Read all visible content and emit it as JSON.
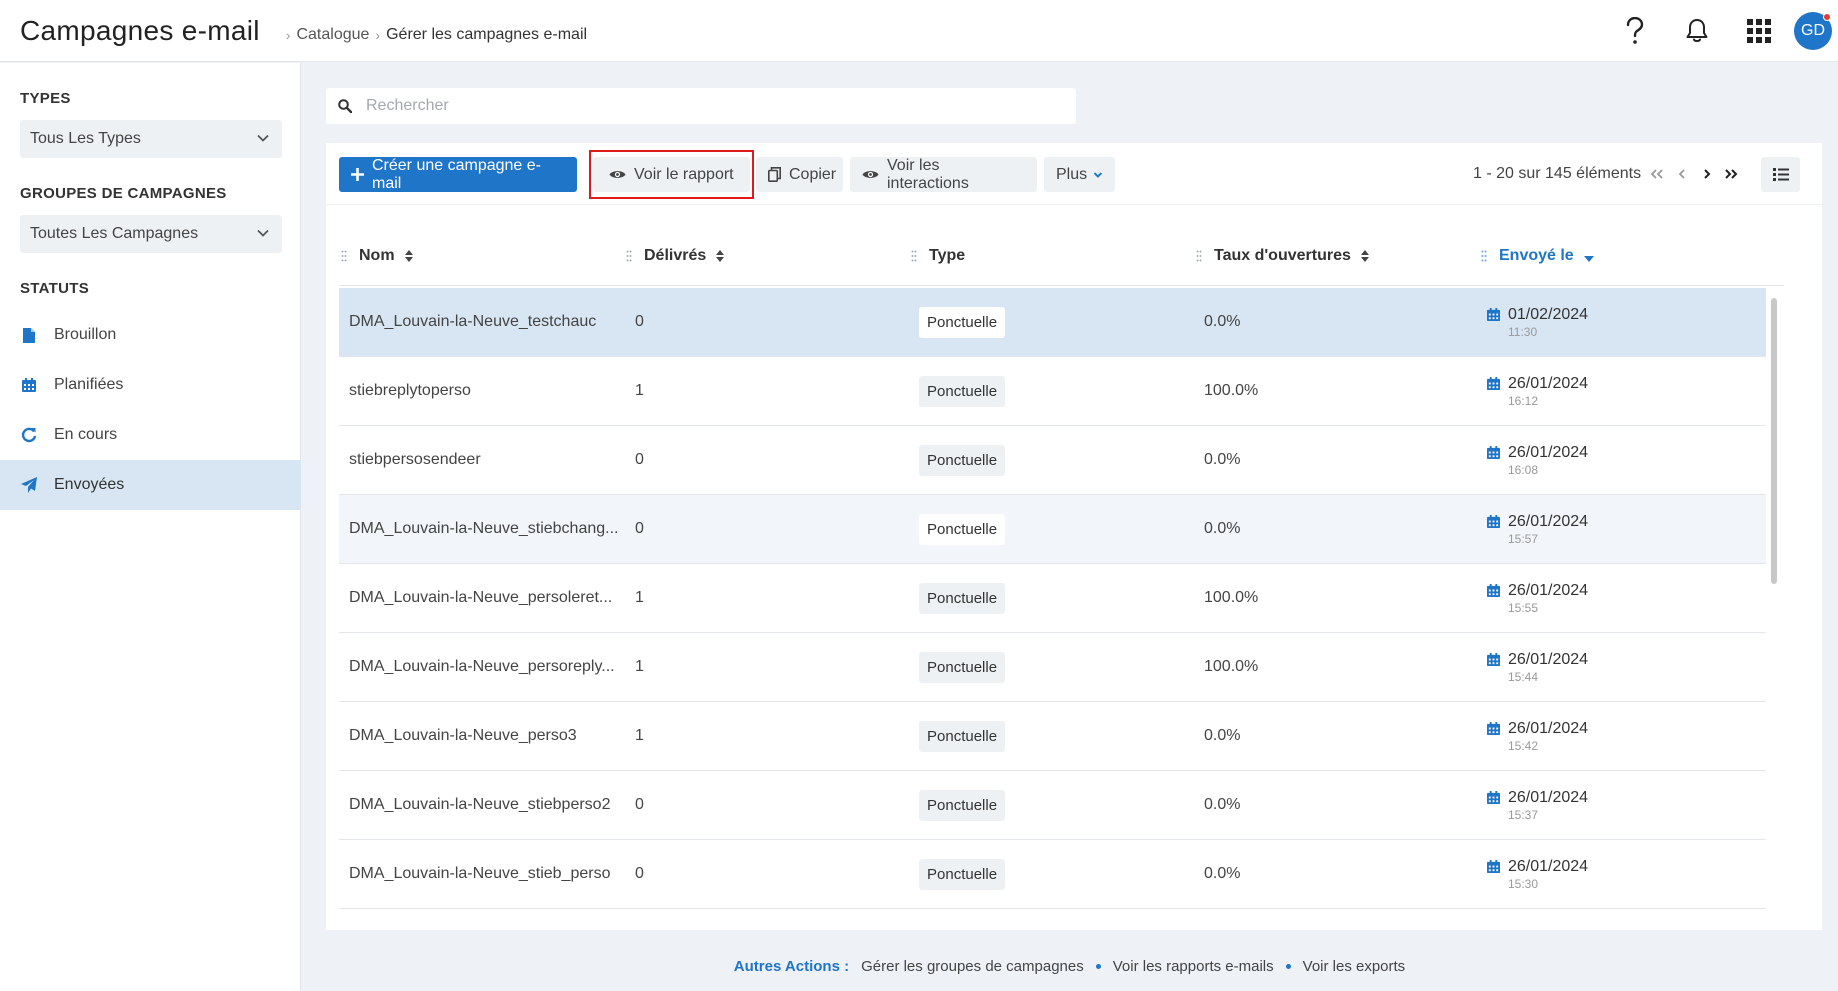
{
  "header": {
    "title": "Campagnes e-mail",
    "breadcrumb": [
      "Catalogue",
      "Gérer les campagnes e-mail"
    ],
    "help_icon": "question-icon",
    "notifications_icon": "bell-icon",
    "apps_icon": "grid-icon",
    "avatar_initials": "GD"
  },
  "sidebar": {
    "types_heading": "TYPES",
    "types_select": "Tous Les Types",
    "groups_heading": "GROUPES DE CAMPAGNES",
    "groups_select": "Toutes Les Campagnes",
    "status_heading": "STATUTS",
    "statuses": [
      {
        "label": "Brouillon",
        "icon": "file-icon"
      },
      {
        "label": "Planifiées",
        "icon": "calendar-icon"
      },
      {
        "label": "En cours",
        "icon": "refresh-icon"
      },
      {
        "label": "Envoyées",
        "icon": "paper-plane-icon",
        "active": true
      }
    ]
  },
  "search": {
    "placeholder": "Rechercher",
    "value": ""
  },
  "toolbar": {
    "create_label": "Créer une campagne e-mail",
    "report_label": "Voir le rapport",
    "copy_label": "Copier",
    "interactions_label": "Voir les interactions",
    "more_label": "Plus",
    "pager_text": "1 - 20 sur 145 éléments"
  },
  "table": {
    "columns": [
      "Nom",
      "Délivrés",
      "Type",
      "Taux d'ouvertures",
      "Envoyé le"
    ],
    "rows": [
      {
        "name": "DMA_Louvain-la-Neuve_testchauc",
        "delivered": "0",
        "type": "Ponctuelle",
        "rate": "0.0%",
        "date": "01/02/2024",
        "time": "11:30"
      },
      {
        "name": "stiebreplytoperso",
        "delivered": "1",
        "type": "Ponctuelle",
        "rate": "100.0%",
        "date": "26/01/2024",
        "time": "16:12"
      },
      {
        "name": "stiebpersosendeer",
        "delivered": "0",
        "type": "Ponctuelle",
        "rate": "0.0%",
        "date": "26/01/2024",
        "time": "16:08"
      },
      {
        "name": "DMA_Louvain-la-Neuve_stiebchang...",
        "delivered": "0",
        "type": "Ponctuelle",
        "rate": "0.0%",
        "date": "26/01/2024",
        "time": "15:57"
      },
      {
        "name": "DMA_Louvain-la-Neuve_persoleret...",
        "delivered": "1",
        "type": "Ponctuelle",
        "rate": "100.0%",
        "date": "26/01/2024",
        "time": "15:55"
      },
      {
        "name": "DMA_Louvain-la-Neuve_persoreply...",
        "delivered": "1",
        "type": "Ponctuelle",
        "rate": "100.0%",
        "date": "26/01/2024",
        "time": "15:44"
      },
      {
        "name": "DMA_Louvain-la-Neuve_perso3",
        "delivered": "1",
        "type": "Ponctuelle",
        "rate": "0.0%",
        "date": "26/01/2024",
        "time": "15:42"
      },
      {
        "name": "DMA_Louvain-la-Neuve_stiebperso2",
        "delivered": "0",
        "type": "Ponctuelle",
        "rate": "0.0%",
        "date": "26/01/2024",
        "time": "15:37"
      },
      {
        "name": "DMA_Louvain-la-Neuve_stieb_perso",
        "delivered": "0",
        "type": "Ponctuelle",
        "rate": "0.0%",
        "date": "26/01/2024",
        "time": "15:30"
      }
    ]
  },
  "footer": {
    "label": "Autres Actions :",
    "links": [
      "Gérer les groupes de campagnes",
      "Voir les rapports e-mails",
      "Voir les exports"
    ]
  },
  "colors": {
    "accent": "#1f75c7",
    "highlight": "#e0191f",
    "selected_row": "#d8e6f3"
  }
}
